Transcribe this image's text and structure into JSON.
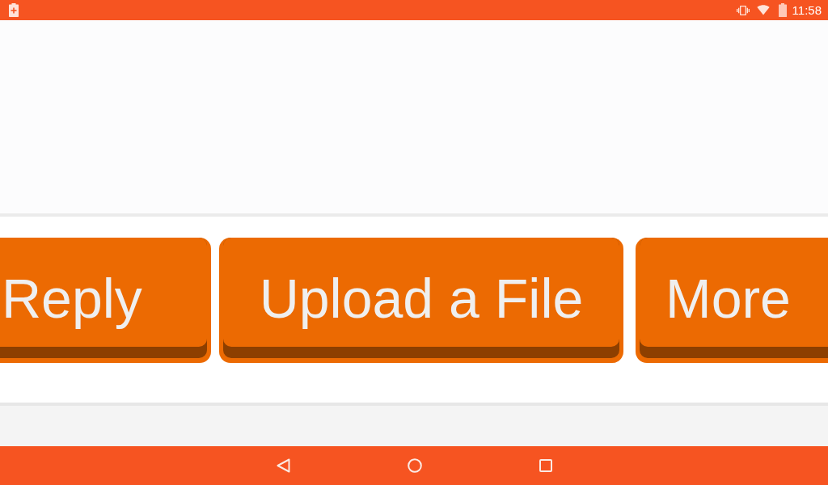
{
  "status_bar": {
    "time": "11:58"
  },
  "action_buttons": [
    {
      "label": "Reply"
    },
    {
      "label": "Upload a File"
    },
    {
      "label": "More"
    }
  ]
}
